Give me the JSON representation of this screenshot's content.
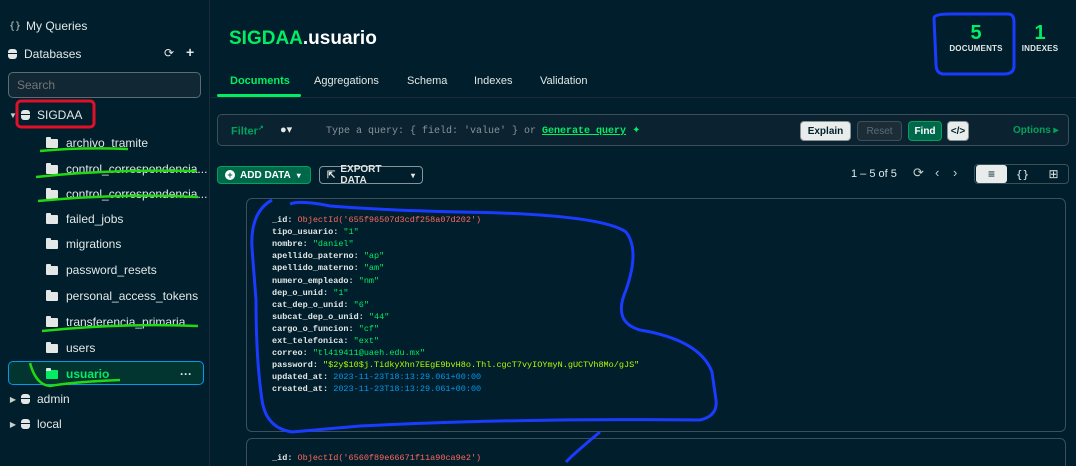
{
  "sidebar": {
    "my_queries": "My Queries",
    "databases": "Databases",
    "search_placeholder": "Search",
    "db_sigdaa": "SIGDAA",
    "collections": [
      "archivo_tramite",
      "control_correspondencia...",
      "control_correspondencia...",
      "failed_jobs",
      "migrations",
      "password_resets",
      "personal_access_tokens",
      "transferencia_primaria",
      "users",
      "usuario"
    ],
    "other_dbs": [
      "admin",
      "local"
    ],
    "more_menu": "···"
  },
  "header": {
    "db_name": "SIGDAA",
    "collection_name": ".usuario",
    "documents_count": "5",
    "documents_label": "DOCUMENTS",
    "indexes_count": "1",
    "indexes_label": "INDEXES"
  },
  "tabs": [
    "Documents",
    "Aggregations",
    "Schema",
    "Indexes",
    "Validation"
  ],
  "filter": {
    "label": "Filter",
    "hint": "Type a query: { field: 'value' } or ",
    "generate_link": "Generate query",
    "explain": "Explain",
    "reset": "Reset",
    "find": "Find",
    "code": "</>",
    "options": "Options"
  },
  "toolbar": {
    "add_data": "ADD DATA",
    "export_data": "EXPORT DATA",
    "pager": "1 – 5 of 5"
  },
  "documents": [
    {
      "fields": [
        {
          "k": "_id",
          "v": "ObjectId('655f96507d3cdf258a07d202')",
          "t": "oid"
        },
        {
          "k": "tipo_usuario",
          "v": "\"1\"",
          "t": "str"
        },
        {
          "k": "nombre",
          "v": "\"daniel\"",
          "t": "str"
        },
        {
          "k": "apellido_paterno",
          "v": "\"ap\"",
          "t": "str"
        },
        {
          "k": "apellido_materno",
          "v": "\"am\"",
          "t": "str"
        },
        {
          "k": "numero_empleado",
          "v": "\"nm\"",
          "t": "str"
        },
        {
          "k": "dep_o_unid",
          "v": "\"1\"",
          "t": "str"
        },
        {
          "k": "cat_dep_o_unid",
          "v": "\"6\"",
          "t": "str"
        },
        {
          "k": "subcat_dep_o_unid",
          "v": "\"44\"",
          "t": "str"
        },
        {
          "k": "cargo_o_funcion",
          "v": "\"cf\"",
          "t": "str"
        },
        {
          "k": "ext_telefonica",
          "v": "\"ext\"",
          "t": "str"
        },
        {
          "k": "correo",
          "v": "\"tl419411@uaeh.edu.mx\"",
          "t": "str"
        },
        {
          "k": "password",
          "v": "\"$2y$10$j.TidkyXhn7EEgE9bvH8o.Thl.cgcT7vyIOYmyN.gUCTVh8Mo/gJS\"",
          "t": "pass"
        },
        {
          "k": "updated_at",
          "v": "2023-11-23T18:13:29.061+00:00",
          "t": "date"
        },
        {
          "k": "created_at",
          "v": "2023-11-23T18:13:29.061+00:00",
          "t": "date"
        }
      ]
    },
    {
      "fields": [
        {
          "k": "_id",
          "v": "ObjectId('6560f89e66671f11a90ca9e2')",
          "t": "oid"
        }
      ]
    }
  ],
  "colors": {
    "background": "#001e2b",
    "accent": "#00ed64",
    "annotation_blue": "#1a3cff",
    "annotation_red": "#e0102a",
    "annotation_green": "#22d814"
  }
}
